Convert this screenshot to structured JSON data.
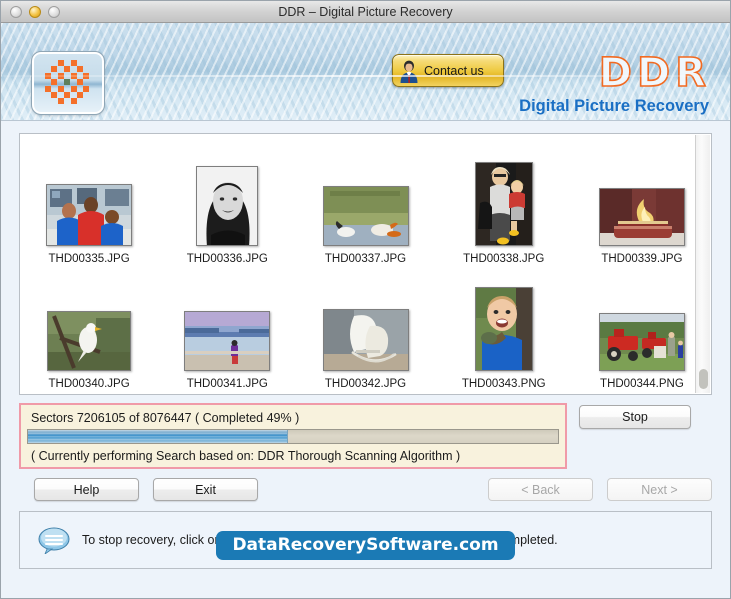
{
  "window": {
    "title": "DDR – Digital Picture Recovery",
    "traffic_lights": [
      "close",
      "minimize",
      "zoom"
    ]
  },
  "header": {
    "app_icon_name": "ddr-flower-icon",
    "contact_button_label": "Contact us",
    "brand_title": "DDR",
    "brand_subtitle": "Digital Picture Recovery"
  },
  "thumbnails": {
    "rows": [
      [
        {
          "name": "THD00335.JPG",
          "kind": "group-photo"
        },
        {
          "name": "THD00336.JPG",
          "kind": "portrait-woman"
        },
        {
          "name": "THD00337.JPG",
          "kind": "birds-water"
        },
        {
          "name": "THD00338.JPG",
          "kind": "woman-with-child"
        },
        {
          "name": "THD00339.JPG",
          "kind": "fireplace-red"
        }
      ],
      [
        {
          "name": "THD00340.JPG",
          "kind": "white-bird-branch"
        },
        {
          "name": "THD00341.JPG",
          "kind": "beach-walker"
        },
        {
          "name": "THD00342.JPG",
          "kind": "ice-skates"
        },
        {
          "name": "THD00343.PNG",
          "kind": "boy-blue-shirt"
        },
        {
          "name": "THD00344.PNG",
          "kind": "red-tractors"
        }
      ]
    ]
  },
  "progress": {
    "status_line": "Sectors 7206105 of 8076447   ( Completed 49% )",
    "percent": 49,
    "sectors_done": 7206105,
    "sectors_total": 8076447,
    "activity_line": "( Currently performing Search based on: DDR Thorough Scanning Algorithm )",
    "border_color": "#f09aa8",
    "panel_color": "#f8f2dd",
    "fill_color": "#3f93cc"
  },
  "buttons": {
    "stop": {
      "label": "Stop",
      "enabled": true
    },
    "help": {
      "label": "Help",
      "enabled": true
    },
    "exit": {
      "label": "Exit",
      "enabled": true
    },
    "back": {
      "label": "< Back",
      "enabled": false
    },
    "next": {
      "label": "Next >",
      "enabled": false
    }
  },
  "info": {
    "icon_name": "speech-bubble-icon",
    "message": "To stop recovery, click on 'Stop' Button or please wait for the process to be completed.",
    "site_badge": "DataRecoverySoftware.com",
    "badge_color": "#1b7ab5"
  }
}
